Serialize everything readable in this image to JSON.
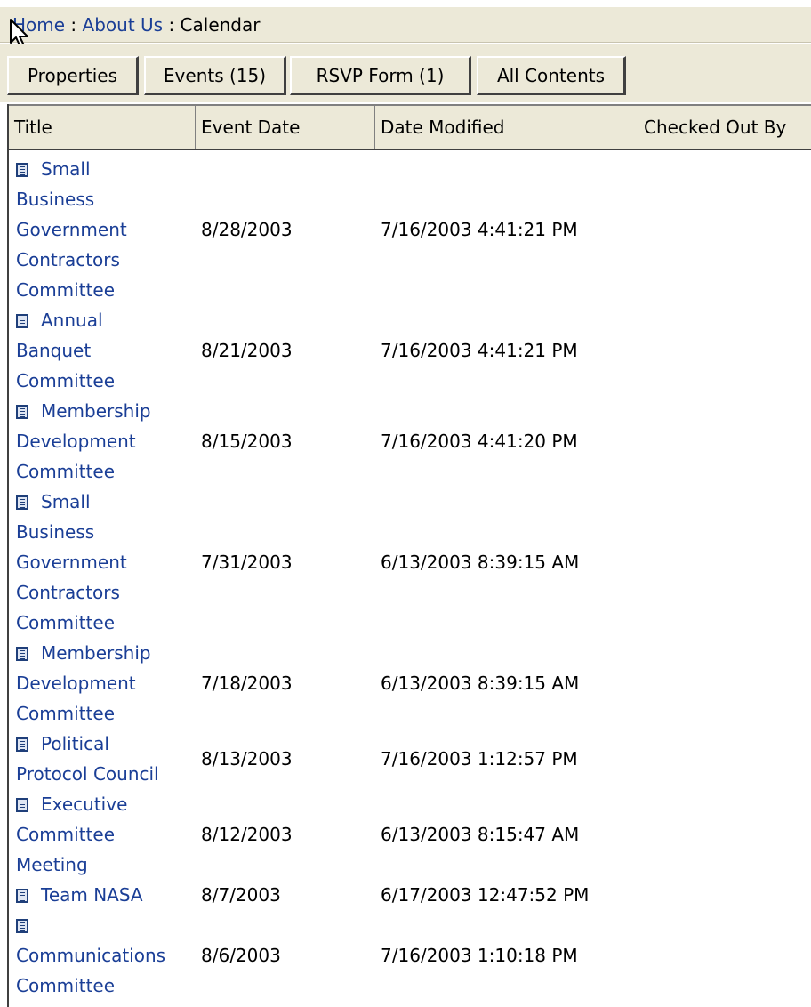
{
  "breadcrumb": {
    "items": [
      "Home",
      "About Us"
    ],
    "separator": ":",
    "current": "Calendar"
  },
  "tabs": [
    {
      "label": "Properties"
    },
    {
      "label": "Events (15)"
    },
    {
      "label": "RSVP Form (1)"
    },
    {
      "label": "All Contents"
    }
  ],
  "active_tab": "Events (15)",
  "table": {
    "columns": [
      "Title",
      "Event Date",
      "Date Modified",
      "Checked Out By"
    ],
    "rows": [
      {
        "title_lines": [
          "Small",
          "Business",
          "Government",
          "Contractors",
          "Committee"
        ],
        "event_date": "8/28/2003",
        "date_modified": "7/16/2003 4:41:21 PM",
        "checked_out_by": ""
      },
      {
        "title_lines": [
          "Annual",
          "Banquet",
          "Committee"
        ],
        "event_date": "8/21/2003",
        "date_modified": "7/16/2003 4:41:21 PM",
        "checked_out_by": ""
      },
      {
        "title_lines": [
          "Membership",
          "Development",
          "Committee"
        ],
        "event_date": "8/15/2003",
        "date_modified": "7/16/2003 4:41:20 PM",
        "checked_out_by": ""
      },
      {
        "title_lines": [
          "Small",
          "Business",
          "Government",
          "Contractors",
          "Committee"
        ],
        "event_date": "7/31/2003",
        "date_modified": "6/13/2003 8:39:15 AM",
        "checked_out_by": ""
      },
      {
        "title_lines": [
          "Membership",
          "Development",
          "Committee"
        ],
        "event_date": "7/18/2003",
        "date_modified": "6/13/2003 8:39:15 AM",
        "checked_out_by": ""
      },
      {
        "title_lines": [
          "Political",
          "Protocol Council"
        ],
        "event_date": "8/13/2003",
        "date_modified": "7/16/2003 1:12:57 PM",
        "checked_out_by": ""
      },
      {
        "title_lines": [
          "Executive",
          "Committee",
          "Meeting"
        ],
        "event_date": "8/12/2003",
        "date_modified": "6/13/2003 8:15:47 AM",
        "checked_out_by": ""
      },
      {
        "title_lines": [
          "Team NASA"
        ],
        "event_date": "8/7/2003",
        "date_modified": "6/17/2003 12:47:52 PM",
        "checked_out_by": ""
      },
      {
        "title_lines": [
          "",
          "Communications",
          "Committee"
        ],
        "event_date": "8/6/2003",
        "date_modified": "7/16/2003 1:10:18 PM",
        "checked_out_by": ""
      }
    ]
  },
  "icons": {
    "row_icon": "document-icon",
    "cursor": "mouse-pointer-icon"
  },
  "colors": {
    "link": "#1a3e96",
    "chrome": "#ece9d8"
  }
}
